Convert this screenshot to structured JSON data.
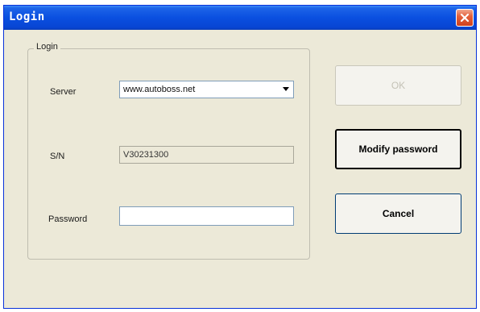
{
  "window": {
    "title": "Login"
  },
  "group": {
    "legend": "Login"
  },
  "form": {
    "server_label": "Server",
    "server_value": "www.autoboss.net",
    "sn_label": "S/N",
    "sn_value": "V30231300",
    "password_label": "Password",
    "password_value": ""
  },
  "buttons": {
    "ok": "OK",
    "modify_password": "Modify password",
    "cancel": "Cancel"
  },
  "icons": {
    "close": "close-icon",
    "dropdown": "chevron-down-icon"
  },
  "colors": {
    "title_bar": "#0a4fe0",
    "close_button": "#e5623c",
    "window_bg": "#ece9d8"
  }
}
